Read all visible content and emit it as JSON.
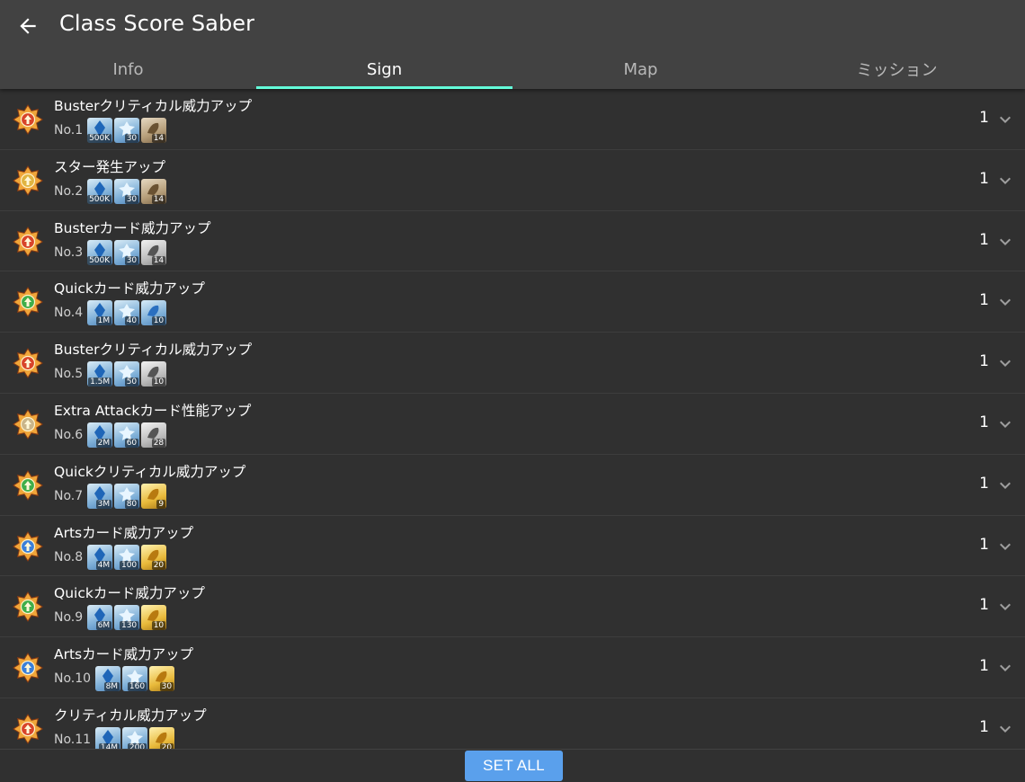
{
  "app": {
    "title": "Class Score Saber",
    "back_icon": "arrow-left-icon"
  },
  "tabs": [
    {
      "label": "Info",
      "active": false
    },
    {
      "label": "Sign",
      "active": true
    },
    {
      "label": "Map",
      "active": false
    },
    {
      "label": "ミッション",
      "active": false
    }
  ],
  "colors": {
    "appbar": "#424242",
    "background": "#303030",
    "tab_indicator": "#64ffda",
    "set_all_button": "#5aa0ec"
  },
  "nodes": [
    {
      "title": "Busterクリティカル威力アップ",
      "no": "No.1",
      "level": "1",
      "icon": "buster-critical-icon",
      "icon_color": "#d8442a",
      "materials": [
        {
          "icon": "crystal-qp-icon",
          "tone": "blue",
          "count": "500K"
        },
        {
          "icon": "saber-piece-icon",
          "tone": "blue",
          "count": "30"
        },
        {
          "icon": "material-bronze-icon",
          "tone": "bronze",
          "count": "14"
        }
      ]
    },
    {
      "title": "スター発生アップ",
      "no": "No.2",
      "level": "1",
      "icon": "star-gen-icon",
      "icon_color": "#e0b441",
      "materials": [
        {
          "icon": "crystal-qp-icon",
          "tone": "blue",
          "count": "500K"
        },
        {
          "icon": "saber-piece-icon",
          "tone": "blue",
          "count": "30"
        },
        {
          "icon": "material-bronze-icon",
          "tone": "bronze",
          "count": "14"
        }
      ]
    },
    {
      "title": "Busterカード威力アップ",
      "no": "No.3",
      "level": "1",
      "icon": "buster-card-icon",
      "icon_color": "#d8442a",
      "materials": [
        {
          "icon": "crystal-qp-icon",
          "tone": "blue",
          "count": "500K"
        },
        {
          "icon": "saber-piece-icon",
          "tone": "blue",
          "count": "30"
        },
        {
          "icon": "material-silver-icon",
          "tone": "silver",
          "count": "14"
        }
      ]
    },
    {
      "title": "Quickカード威力アップ",
      "no": "No.4",
      "level": "1",
      "icon": "quick-card-icon",
      "icon_color": "#3fae4a",
      "materials": [
        {
          "icon": "crystal-qp-icon",
          "tone": "blue",
          "count": "1M"
        },
        {
          "icon": "saber-piece-icon",
          "tone": "blue",
          "count": "40"
        },
        {
          "icon": "material-blue-icon",
          "tone": "blue",
          "count": "10"
        }
      ]
    },
    {
      "title": "Busterクリティカル威力アップ",
      "no": "No.5",
      "level": "1",
      "icon": "buster-critical-icon",
      "icon_color": "#d8442a",
      "materials": [
        {
          "icon": "crystal-qp-icon",
          "tone": "blue",
          "count": "1.5M"
        },
        {
          "icon": "saber-piece-icon",
          "tone": "blue",
          "count": "50"
        },
        {
          "icon": "material-silver-icon",
          "tone": "silver",
          "count": "10"
        }
      ]
    },
    {
      "title": "Extra Attackカード性能アップ",
      "no": "No.6",
      "level": "1",
      "icon": "extra-attack-icon",
      "icon_color": "#c9b58a",
      "materials": [
        {
          "icon": "crystal-qp-icon",
          "tone": "blue",
          "count": "2M"
        },
        {
          "icon": "saber-piece-icon",
          "tone": "blue",
          "count": "60"
        },
        {
          "icon": "material-silver-icon",
          "tone": "silver",
          "count": "28"
        }
      ]
    },
    {
      "title": "Quickクリティカル威力アップ",
      "no": "No.7",
      "level": "1",
      "icon": "quick-critical-icon",
      "icon_color": "#3fae4a",
      "materials": [
        {
          "icon": "crystal-qp-icon",
          "tone": "blue",
          "count": "3M"
        },
        {
          "icon": "saber-piece-icon",
          "tone": "blue",
          "count": "80"
        },
        {
          "icon": "material-gold-icon",
          "tone": "gold",
          "count": "9"
        }
      ]
    },
    {
      "title": "Artsカード威力アップ",
      "no": "No.8",
      "level": "1",
      "icon": "arts-card-icon",
      "icon_color": "#3b7fd9",
      "materials": [
        {
          "icon": "crystal-qp-icon",
          "tone": "blue",
          "count": "4M"
        },
        {
          "icon": "saber-piece-icon",
          "tone": "blue",
          "count": "100"
        },
        {
          "icon": "material-gold-icon",
          "tone": "gold",
          "count": "20"
        }
      ]
    },
    {
      "title": "Quickカード威力アップ",
      "no": "No.9",
      "level": "1",
      "icon": "quick-card-icon",
      "icon_color": "#3fae4a",
      "materials": [
        {
          "icon": "crystal-qp-icon",
          "tone": "blue",
          "count": "6M"
        },
        {
          "icon": "saber-piece-icon",
          "tone": "blue",
          "count": "130"
        },
        {
          "icon": "material-gold-icon",
          "tone": "gold",
          "count": "10"
        }
      ]
    },
    {
      "title": "Artsカード威力アップ",
      "no": "No.10",
      "level": "1",
      "icon": "arts-card-icon",
      "icon_color": "#3b7fd9",
      "materials": [
        {
          "icon": "crystal-qp-icon",
          "tone": "blue",
          "count": "8M"
        },
        {
          "icon": "saber-piece-icon",
          "tone": "blue",
          "count": "160"
        },
        {
          "icon": "material-gold-icon",
          "tone": "gold",
          "count": "30"
        }
      ]
    },
    {
      "title": "クリティカル威力アップ",
      "no": "No.11",
      "level": "1",
      "icon": "critical-icon",
      "icon_color": "#d8442a",
      "materials": [
        {
          "icon": "crystal-qp-icon",
          "tone": "blue",
          "count": "14M"
        },
        {
          "icon": "saber-piece-icon",
          "tone": "blue",
          "count": "200"
        },
        {
          "icon": "material-gold-icon",
          "tone": "gold",
          "count": "20"
        }
      ]
    }
  ],
  "footer": {
    "set_all_label": "SET ALL"
  }
}
